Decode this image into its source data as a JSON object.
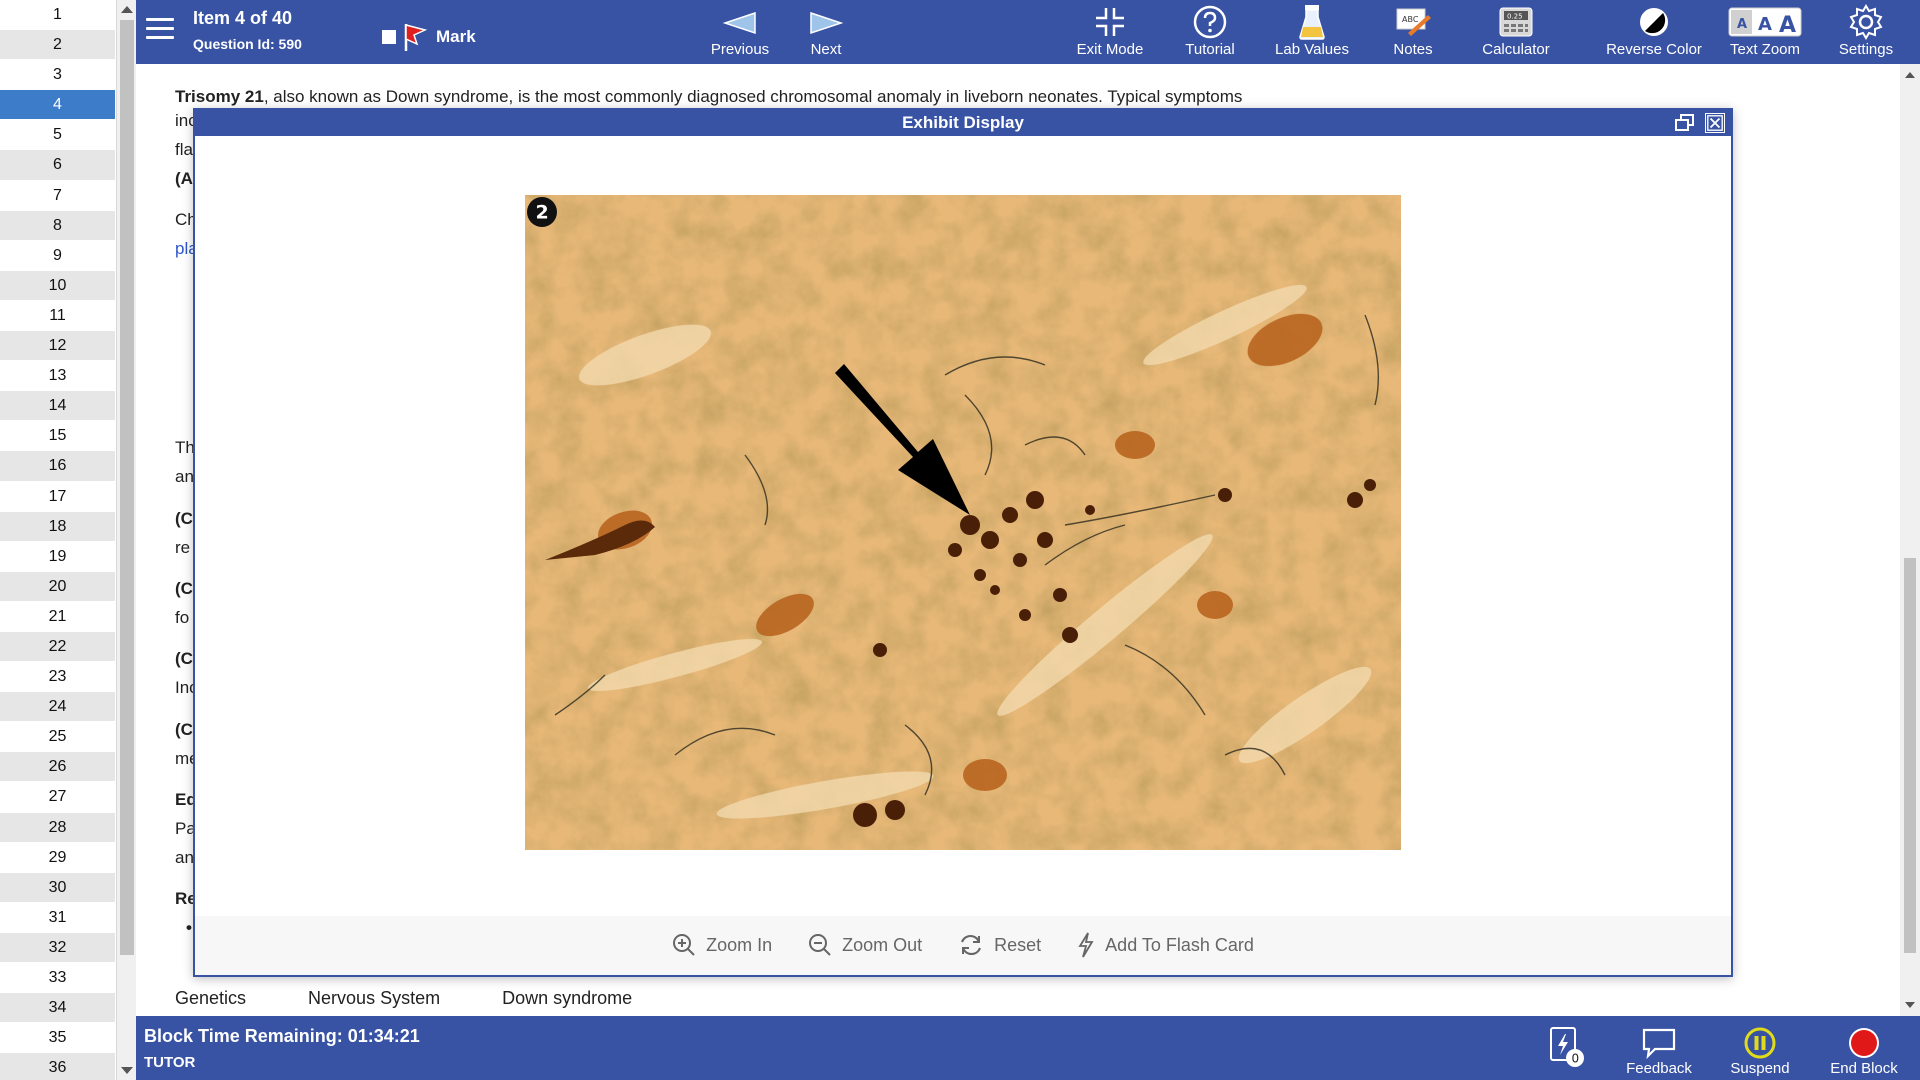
{
  "sidebar": {
    "items": [
      "1",
      "2",
      "3",
      "4",
      "5",
      "6",
      "7",
      "8",
      "9",
      "10",
      "11",
      "12",
      "13",
      "14",
      "15",
      "16",
      "17",
      "18",
      "19",
      "20",
      "21",
      "22",
      "23",
      "24",
      "25",
      "26",
      "27",
      "28",
      "29",
      "30",
      "31",
      "32",
      "33",
      "34",
      "35",
      "36"
    ],
    "active_item": "4"
  },
  "header": {
    "item_title": "Item 4 of 40",
    "question_id": "Question Id: 590",
    "mark_label": "Mark",
    "nav": {
      "previous": "Previous",
      "next": "Next"
    },
    "tools": {
      "exit_mode": "Exit Mode",
      "tutorial": "Tutorial",
      "lab_values": "Lab Values",
      "notes": "Notes",
      "calculator": "Calculator",
      "calculator_display": "0.25",
      "notes_icon_text": "ABC",
      "reverse_color": "Reverse Color",
      "text_zoom": "Text Zoom",
      "settings": "Settings"
    }
  },
  "explanation": {
    "topic_bold": "Trisomy 21",
    "first_line": ", also known as Down syndrome, is the most commonly diagnosed chromosomal anomaly in liveborn neonates.  Typical symptoms",
    "stubs": [
      "inc",
      "fla",
      "(A",
      "Ch",
      "pla",
      "Th",
      "an",
      "(C",
      "re",
      "(C",
      "fo",
      "(C",
      "Inc",
      "(C",
      "me",
      "Ed",
      "Pa",
      "an",
      "Re",
      "•"
    ]
  },
  "tags": [
    "Genetics",
    "Nervous System",
    "Down syndrome"
  ],
  "exhibit": {
    "title": "Exhibit Display",
    "image_badge": "2",
    "buttons": {
      "zoom_in": "Zoom In",
      "zoom_out": "Zoom Out",
      "reset": "Reset",
      "add_flash": "Add To Flash Card"
    }
  },
  "footer": {
    "time_remaining": "Block Time Remaining: 01:34:21",
    "mode": "TUTOR",
    "flash_count": "0",
    "feedback": "Feedback",
    "suspend": "Suspend",
    "end_block": "End Block"
  },
  "colors": {
    "toolbar_bg": "#3852a4",
    "active_item_bg": "#3d7cc9",
    "stain_bg": "#d9a15a",
    "suspend_yellow": "#e0dc1a",
    "end_red": "#e01818"
  }
}
